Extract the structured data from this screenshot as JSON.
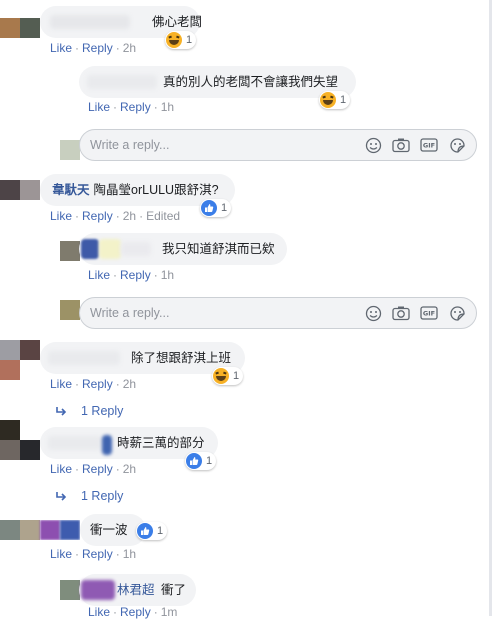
{
  "placeholder": "Write a reply...",
  "labels": {
    "like": "Like",
    "reply": "Reply",
    "edited": "Edited",
    "dot": "·"
  },
  "comments": [
    {
      "text": "佛心老闆",
      "time": "2h",
      "reaction": "haha",
      "count": "1"
    },
    {
      "text": "真的別人的老闆不會讓我們失望",
      "time": "1h",
      "reaction": "haha",
      "count": "1"
    },
    {
      "author": "韋馱天",
      "text": "陶晶瑩orLULU跟舒淇?",
      "time": "2h",
      "reaction": "like",
      "count": "1"
    },
    {
      "text": "我只知道舒淇而已欸",
      "time": "1h"
    },
    {
      "text": "除了想跟舒淇上班",
      "time": "2h",
      "reaction": "haha",
      "count": "1",
      "replies": "1 Reply"
    },
    {
      "text": "時薪三萬的部分",
      "time": "2h",
      "reaction": "like",
      "count": "1",
      "replies": "1 Reply"
    },
    {
      "text": "衝一波",
      "time": "1h",
      "reaction": "like",
      "count": "1"
    },
    {
      "author": "林君超",
      "text": "衝了",
      "time": "1m"
    }
  ],
  "icons": [
    "emoji-icon",
    "camera-icon",
    "gif-icon",
    "sticker-icon",
    "haha-reaction-icon",
    "like-reaction-icon",
    "reply-arrow-icon"
  ],
  "colors": {
    "link": "#4267b2",
    "author": "#365899",
    "bubble": "#f2f3f5",
    "meta": "#90949c",
    "like": "#3b7ee8",
    "haha": "#f7b125"
  }
}
